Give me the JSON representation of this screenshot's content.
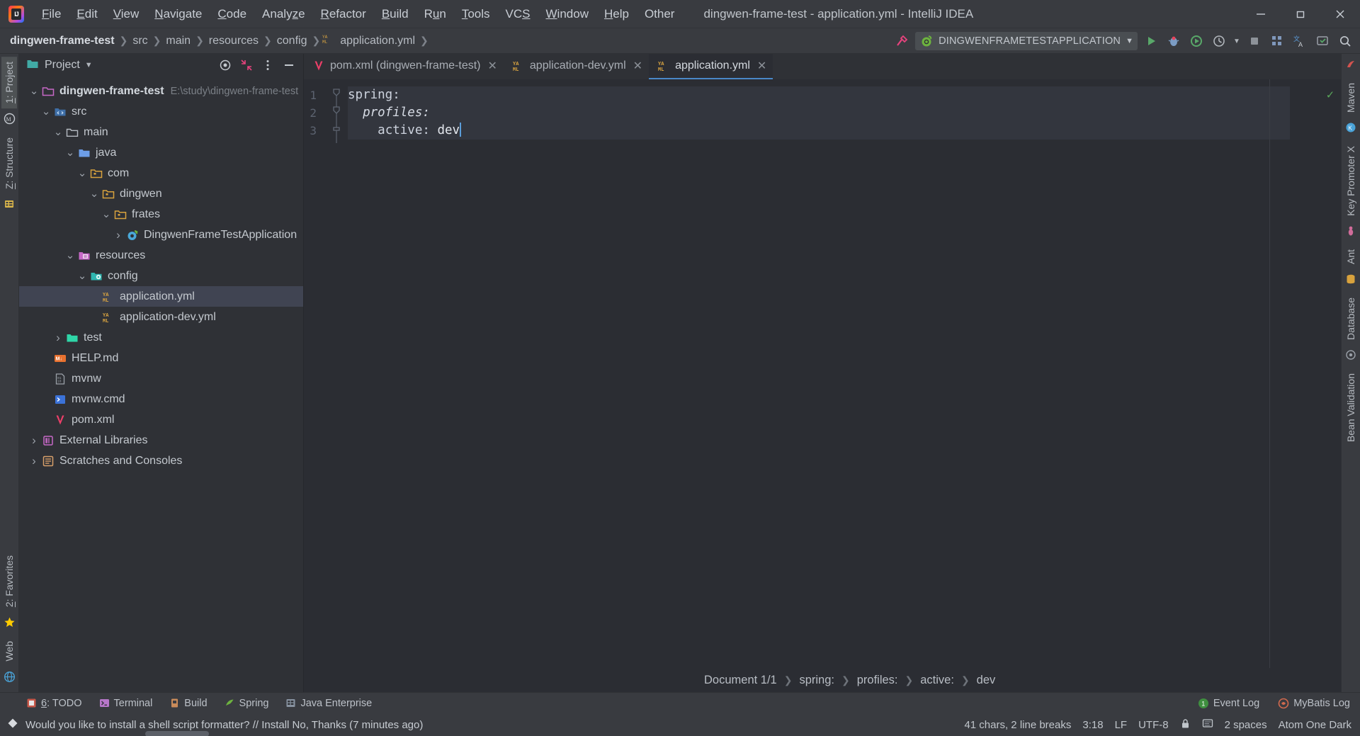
{
  "window": {
    "title": "dingwen-frame-test - application.yml - IntelliJ IDEA",
    "minimize": "—",
    "maximize": "❐",
    "close": "✕"
  },
  "menu": [
    {
      "label": "File",
      "mnemonic": "F"
    },
    {
      "label": "Edit",
      "mnemonic": "E"
    },
    {
      "label": "View",
      "mnemonic": "V"
    },
    {
      "label": "Navigate",
      "mnemonic": "N"
    },
    {
      "label": "Code",
      "mnemonic": "C"
    },
    {
      "label": "Analyze",
      "mnemonic": "z"
    },
    {
      "label": "Refactor",
      "mnemonic": "R"
    },
    {
      "label": "Build",
      "mnemonic": "B"
    },
    {
      "label": "Run",
      "mnemonic": "u"
    },
    {
      "label": "Tools",
      "mnemonic": "T"
    },
    {
      "label": "VCS",
      "mnemonic": "S"
    },
    {
      "label": "Window",
      "mnemonic": "W"
    },
    {
      "label": "Help",
      "mnemonic": "H"
    },
    {
      "label": "Other",
      "mnemonic": ""
    }
  ],
  "navbar": {
    "crumbs": [
      {
        "label": "dingwen-frame-test",
        "bold": true,
        "icon": "folder-icon"
      },
      {
        "label": "src",
        "bold": false,
        "icon": ""
      },
      {
        "label": "main",
        "bold": false,
        "icon": ""
      },
      {
        "label": "resources",
        "bold": false,
        "icon": ""
      },
      {
        "label": "config",
        "bold": false,
        "icon": ""
      },
      {
        "label": "application.yml",
        "bold": false,
        "icon": "yaml-icon"
      }
    ],
    "separator": "❯",
    "run_config": "DINGWENFRAMETESTAPPLICATION",
    "icons": {
      "hammer": "build-hammer-icon",
      "dropdown": "chevron-down-icon",
      "run": "run-icon",
      "debug": "debug-icon",
      "run_coverage": "run-with-coverage-icon",
      "profiler": "profiler-icon",
      "stop": "stop-icon",
      "grid": "grid-icon",
      "translate": "translate-icon",
      "updates": "updates-icon",
      "search": "search-icon"
    }
  },
  "left_strip": {
    "tabs": [
      {
        "label": "1: Project",
        "mnemonic": "1",
        "active": true
      },
      {
        "label": "Z: Structure",
        "mnemonic": "Z",
        "active": false
      },
      {
        "label": "2: Favorites",
        "mnemonic": "2",
        "active": false
      },
      {
        "label": "Web",
        "mnemonic": "",
        "active": false
      }
    ],
    "icons": [
      "maven-circle-icon",
      "database-table-icon",
      "star-icon",
      "web-globe-icon"
    ]
  },
  "right_strip": {
    "tabs": [
      {
        "label": "Maven",
        "icon": "maven-icon"
      },
      {
        "label": "Key Promoter X",
        "icon": "key-promoter-icon"
      },
      {
        "label": "Ant",
        "icon": "ant-icon"
      },
      {
        "label": "Database",
        "icon": "database-icon"
      },
      {
        "label": "Bean Validation",
        "icon": "bean-validation-icon"
      }
    ]
  },
  "project_panel": {
    "title": "Project",
    "title_chevron": "chevron-down-icon",
    "actions": [
      "target-locate-icon",
      "collapse-all-icon",
      "options-more-icon",
      "hide-minimize-icon"
    ],
    "tree": [
      {
        "depth": 0,
        "label": "dingwen-frame-test",
        "path": "E:\\study\\dingwen-frame-test",
        "arrow": "down",
        "icon": "project-folder-icon",
        "bold": true,
        "selected": false
      },
      {
        "depth": 1,
        "label": "src",
        "path": "",
        "arrow": "down",
        "icon": "source-root-icon",
        "bold": false,
        "selected": false
      },
      {
        "depth": 2,
        "label": "main",
        "path": "",
        "arrow": "down",
        "icon": "folder-icon",
        "bold": false,
        "selected": false
      },
      {
        "depth": 3,
        "label": "java",
        "path": "",
        "arrow": "down",
        "icon": "java-source-folder-icon",
        "bold": false,
        "selected": false
      },
      {
        "depth": 4,
        "label": "com",
        "path": "",
        "arrow": "down",
        "icon": "package-icon",
        "bold": false,
        "selected": false
      },
      {
        "depth": 5,
        "label": "dingwen",
        "path": "",
        "arrow": "down",
        "icon": "package-icon",
        "bold": false,
        "selected": false
      },
      {
        "depth": 6,
        "label": "frates",
        "path": "",
        "arrow": "down",
        "icon": "package-icon",
        "bold": false,
        "selected": false
      },
      {
        "depth": 7,
        "label": "DingwenFrameTestApplication",
        "path": "",
        "arrow": "right",
        "icon": "spring-boot-class-icon",
        "bold": false,
        "selected": false
      },
      {
        "depth": 3,
        "label": "resources",
        "path": "",
        "arrow": "down",
        "icon": "resources-root-icon",
        "bold": false,
        "selected": false
      },
      {
        "depth": 4,
        "label": "config",
        "path": "",
        "arrow": "down",
        "icon": "config-folder-icon",
        "bold": false,
        "selected": false
      },
      {
        "depth": 5,
        "label": "application.yml",
        "path": "",
        "arrow": "none",
        "icon": "yaml-icon",
        "bold": false,
        "selected": true
      },
      {
        "depth": 5,
        "label": "application-dev.yml",
        "path": "",
        "arrow": "none",
        "icon": "yaml-icon",
        "bold": false,
        "selected": false
      },
      {
        "depth": 2,
        "label": "test",
        "path": "",
        "arrow": "right",
        "icon": "test-root-icon",
        "bold": false,
        "selected": false
      },
      {
        "depth": 1,
        "label": "HELP.md",
        "path": "",
        "arrow": "none",
        "icon": "markdown-icon",
        "bold": false,
        "selected": false
      },
      {
        "depth": 1,
        "label": "mvnw",
        "path": "",
        "arrow": "none",
        "icon": "binary-file-icon",
        "bold": false,
        "selected": false
      },
      {
        "depth": 1,
        "label": "mvnw.cmd",
        "path": "",
        "arrow": "none",
        "icon": "cmd-script-icon",
        "bold": false,
        "selected": false
      },
      {
        "depth": 1,
        "label": "pom.xml",
        "path": "",
        "arrow": "none",
        "icon": "maven-pom-icon",
        "bold": false,
        "selected": false
      },
      {
        "depth": 0,
        "label": "External Libraries",
        "path": "",
        "arrow": "right",
        "icon": "libraries-icon",
        "bold": false,
        "selected": false
      },
      {
        "depth": 0,
        "label": "Scratches and Consoles",
        "path": "",
        "arrow": "right",
        "icon": "scratches-icon",
        "bold": false,
        "selected": false
      }
    ]
  },
  "editor": {
    "tabs": [
      {
        "label": "pom.xml (dingwen-frame-test)",
        "icon": "maven-pom-icon",
        "active": false,
        "close": "✕"
      },
      {
        "label": "application-dev.yml",
        "icon": "yaml-icon",
        "active": false,
        "close": "✕"
      },
      {
        "label": "application.yml",
        "icon": "yaml-icon",
        "active": true,
        "close": "✕"
      }
    ],
    "line_numbers": [
      "1",
      "2",
      "3"
    ],
    "lines": [
      {
        "indent": "",
        "key": "spring:",
        "value": "",
        "italic": false
      },
      {
        "indent": "  ",
        "key": "profiles:",
        "value": "",
        "italic": true
      },
      {
        "indent": "    ",
        "key": "active:",
        "value": " dev",
        "italic": false
      }
    ],
    "inspection_status": "✓",
    "breadcrumb": [
      "Document 1/1",
      "spring:",
      "profiles:",
      "active:",
      "dev"
    ],
    "breadcrumb_sep": "❯"
  },
  "bottom_toolwindows": [
    {
      "label": "6: TODO",
      "mnemonic": "6",
      "icon": "todo-icon"
    },
    {
      "label": "Terminal",
      "mnemonic": "",
      "icon": "terminal-icon"
    },
    {
      "label": "Build",
      "mnemonic": "",
      "icon": "build-icon"
    },
    {
      "label": "Spring",
      "mnemonic": "",
      "icon": "spring-leaf-icon"
    },
    {
      "label": "Java Enterprise",
      "mnemonic": "",
      "icon": "java-enterprise-icon"
    }
  ],
  "bottom_right": [
    {
      "label": "Event Log",
      "icon": "event-log-icon",
      "badge": "1"
    },
    {
      "label": "MyBatis Log",
      "icon": "mybatis-icon",
      "badge": ""
    }
  ],
  "statusbar": {
    "message": "Would you like to install a shell script formatter? // Install   No, Thanks (7 minutes ago)",
    "message_icon": "notification-diamond-icon",
    "chars": "41 chars, 2 line breaks",
    "caret_position": "3:18",
    "line_separator": "LF",
    "encoding": "UTF-8",
    "lock_icon": "lock-icon",
    "inspection_icon": "inspections-eye-icon",
    "indent": "2 spaces",
    "theme": "Atom One Dark"
  },
  "colors": {
    "accent_blue": "#4a88c7",
    "panel_bg": "#2f3136",
    "editor_bg": "#2b2d33",
    "chrome_bg": "#393b40",
    "selection": "#404452",
    "yaml_yellow": "#d9a441",
    "maven_pink": "#ee3f69",
    "spring_green": "#6db33f"
  }
}
